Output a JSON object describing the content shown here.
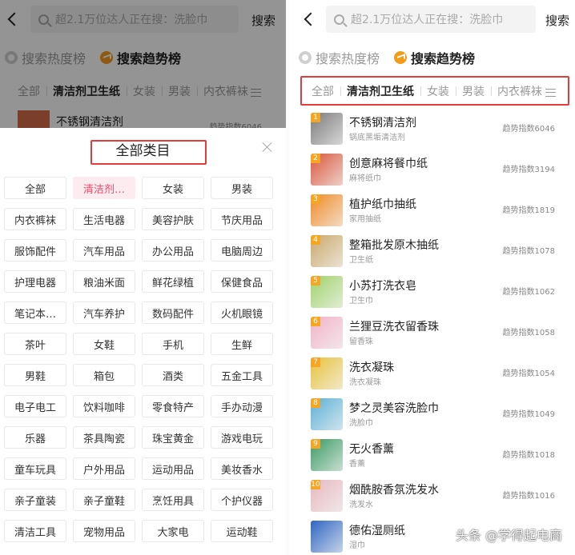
{
  "left": {
    "search": {
      "placeholder": "超2.1万位达人正在搜：洗脸巾",
      "button": "搜索"
    },
    "rank_tabs": [
      {
        "label": "搜索热度榜",
        "active": false
      },
      {
        "label": "搜索趋势榜",
        "active": true
      }
    ],
    "category_bar": [
      "全部",
      "清洁剂卫生纸",
      "女装",
      "男装",
      "内衣裤袜"
    ],
    "peek_item": {
      "name": "不锈钢清洁剂",
      "index": "趋势指数6046"
    },
    "sheet": {
      "title": "全部类目",
      "categories": [
        "全部",
        "清洁剂…",
        "女装",
        "男装",
        "内衣裤袜",
        "生活电器",
        "美容护肤",
        "节庆用品",
        "服饰配件",
        "汽车用品",
        "办公用品",
        "电脑周边",
        "护理电器",
        "粮油米面",
        "鲜花绿植",
        "保健食品",
        "笔记本…",
        "汽车养护",
        "数码配件",
        "火机眼镜",
        "茶叶",
        "女鞋",
        "手机",
        "生鲜",
        "男鞋",
        "箱包",
        "酒类",
        "五金工具",
        "电子电工",
        "饮料咖啡",
        "零食特产",
        "手办动漫",
        "乐器",
        "茶具陶瓷",
        "珠宝黄金",
        "游戏电玩",
        "童车玩具",
        "户外用品",
        "运动用品",
        "美妆香水",
        "亲子童装",
        "亲子童鞋",
        "烹饪用具",
        "个护仪器",
        "清洁工具",
        "宠物用品",
        "大家电",
        "运动鞋"
      ],
      "active_index": 1
    }
  },
  "right": {
    "search": {
      "placeholder": "超2.1万位达人正在搜：洗脸巾",
      "button": "搜索"
    },
    "rank_tabs": [
      {
        "label": "搜索热度榜",
        "active": false
      },
      {
        "label": "搜索趋势榜",
        "active": true
      }
    ],
    "category_bar": [
      "全部",
      "清洁剂卫生纸",
      "女装",
      "男装",
      "内衣裤袜"
    ],
    "items": [
      {
        "rank": "1",
        "name": "不锈钢清洁剂",
        "sub": "锅底黑垢清洁剂",
        "index": "趋势指数6046",
        "color": "#7a7a7a"
      },
      {
        "rank": "2",
        "name": "创意麻将餐巾纸",
        "sub": "麻将纸巾",
        "index": "趋势指数3194",
        "color": "#d9573c"
      },
      {
        "rank": "3",
        "name": "植护纸巾抽纸",
        "sub": "家用抽纸",
        "index": "趋势指数1819",
        "color": "#f08a24"
      },
      {
        "rank": "4",
        "name": "整箱批发原木抽纸",
        "sub": "卫生纸",
        "index": "趋势指数1078",
        "color": "#c9a86a"
      },
      {
        "rank": "5",
        "name": "小苏打洗衣皂",
        "sub": "卫生巾",
        "index": "趋势指数1062",
        "color": "#9fd36a"
      },
      {
        "rank": "6",
        "name": "兰狸豆洗衣留香珠",
        "sub": "留香珠",
        "index": "趋势指数1058",
        "color": "#f2b3c8"
      },
      {
        "rank": "7",
        "name": "洗衣凝珠",
        "sub": "洗衣凝珠",
        "index": "趋势指数1054",
        "color": "#e8c23a"
      },
      {
        "rank": "8",
        "name": "梦之灵美容洗脸巾",
        "sub": "洗脸巾",
        "index": "趋势指数1049",
        "color": "#5ab0d6"
      },
      {
        "rank": "9",
        "name": "无火香薰",
        "sub": "香薰",
        "index": "趋势指数1018",
        "color": "#3a9a62"
      },
      {
        "rank": "10",
        "name": "烟酰胺香氛洗发水",
        "sub": "洗发水",
        "index": "趋势指数1016",
        "color": "#e6b8c0"
      },
      {
        "rank": "",
        "name": "德佑湿厕纸",
        "sub": "湿巾",
        "index": "",
        "color": "#2f66c2"
      }
    ],
    "watermark": "头条 @学得起电商"
  }
}
